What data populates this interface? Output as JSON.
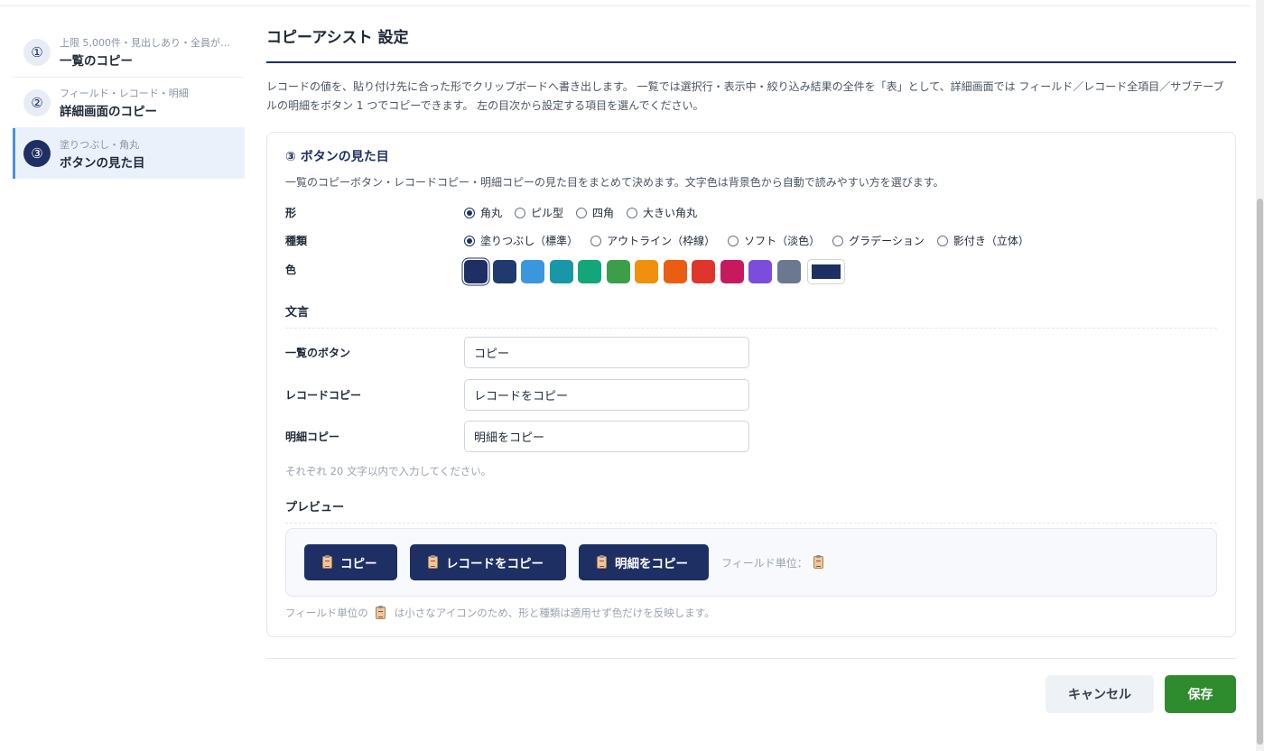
{
  "sidebar": {
    "items": [
      {
        "num": "①",
        "sub": "上限 5,000件・見出しあり・全員が…",
        "title": "一覧のコピー",
        "active": false
      },
      {
        "num": "②",
        "sub": "フィールド・レコード・明細",
        "title": "詳細画面のコピー",
        "active": false
      },
      {
        "num": "③",
        "sub": "塗りつぶし・角丸",
        "title": "ボタンの見た目",
        "active": true
      }
    ]
  },
  "main": {
    "title": "コピーアシスト 設定",
    "intro": "レコードの値を、貼り付け先に合った形でクリップボードへ書き出します。 一覧では選択行・表示中・絞り込み結果の全件を「表」として、詳細画面では フィールド／レコード全項目／サブテーブルの明細をボタン 1 つでコピーできます。 左の目次から設定する項目を選んでください。"
  },
  "card": {
    "title": "③ ボタンの見た目",
    "desc": "一覧のコピーボタン・レコードコピー・明細コピーの見た目をまとめて決めます。文字色は背景色から自動で読みやすい方を選びます。",
    "shape": {
      "label": "形",
      "options": [
        "角丸",
        "ピル型",
        "四角",
        "大きい角丸"
      ],
      "selected": "角丸"
    },
    "kind": {
      "label": "種類",
      "options": [
        "塗りつぶし（標準）",
        "アウトライン（枠線）",
        "ソフト（淡色）",
        "グラデーション",
        "影付き（立体）"
      ],
      "selected": "塗りつぶし（標準）"
    },
    "color": {
      "label": "色",
      "swatches": [
        "#1e2f63",
        "#1f3a6e",
        "#3b97dd",
        "#1897a8",
        "#13a679",
        "#3d9e4a",
        "#f0900c",
        "#ea5d12",
        "#e0352d",
        "#c71a5e",
        "#7c4ddc",
        "#6b7990"
      ],
      "selected_index": 0,
      "custom": "#1e2f63"
    },
    "wording": {
      "heading": "文言",
      "list_button": {
        "label": "一覧のボタン",
        "value": "コピー"
      },
      "record_copy": {
        "label": "レコードコピー",
        "value": "レコードをコピー"
      },
      "detail_copy": {
        "label": "明細コピー",
        "value": "明細をコピー"
      },
      "hint": "それぞれ 20 文字以内で入力してください。"
    },
    "preview": {
      "heading": "プレビュー",
      "buttons": [
        "コピー",
        "レコードをコピー",
        "明細をコピー"
      ],
      "field_unit": "フィールド単位：",
      "note_before": "フィールド単位の",
      "note_after": "は小さなアイコンのため、形と種類は適用せず色だけを反映します。"
    }
  },
  "footer": {
    "cancel": "キャンセル",
    "save": "保存",
    "cancel_color": "#eef1f5",
    "save_color": "#2e8b2e"
  }
}
